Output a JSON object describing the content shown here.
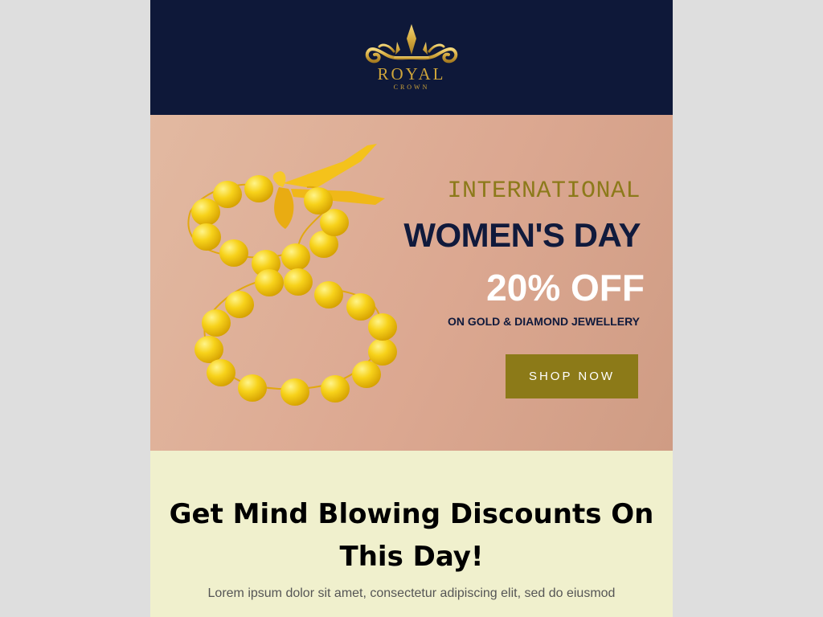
{
  "brand": {
    "name": "ROYAL",
    "tagline": "CROWN",
    "accent_color": "#cfa53a",
    "header_bg": "#0e1839"
  },
  "hero": {
    "eyebrow": "INTERNATIONAL",
    "title": "WOMEN'S DAY",
    "offer": "20% OFF",
    "subtitle": "ON GOLD & DIAMOND JEWELLERY",
    "cta_label": "SHOP NOW",
    "cta_color": "#8c7a18",
    "image_subject": "yellow-bead-bracelet-figure-eight"
  },
  "content": {
    "heading": "Get Mind Blowing Discounts On This Day!",
    "body": "Lorem ipsum dolor sit amet, consectetur adipiscing elit, sed do eiusmod",
    "bg_color": "#f0f0cd"
  }
}
